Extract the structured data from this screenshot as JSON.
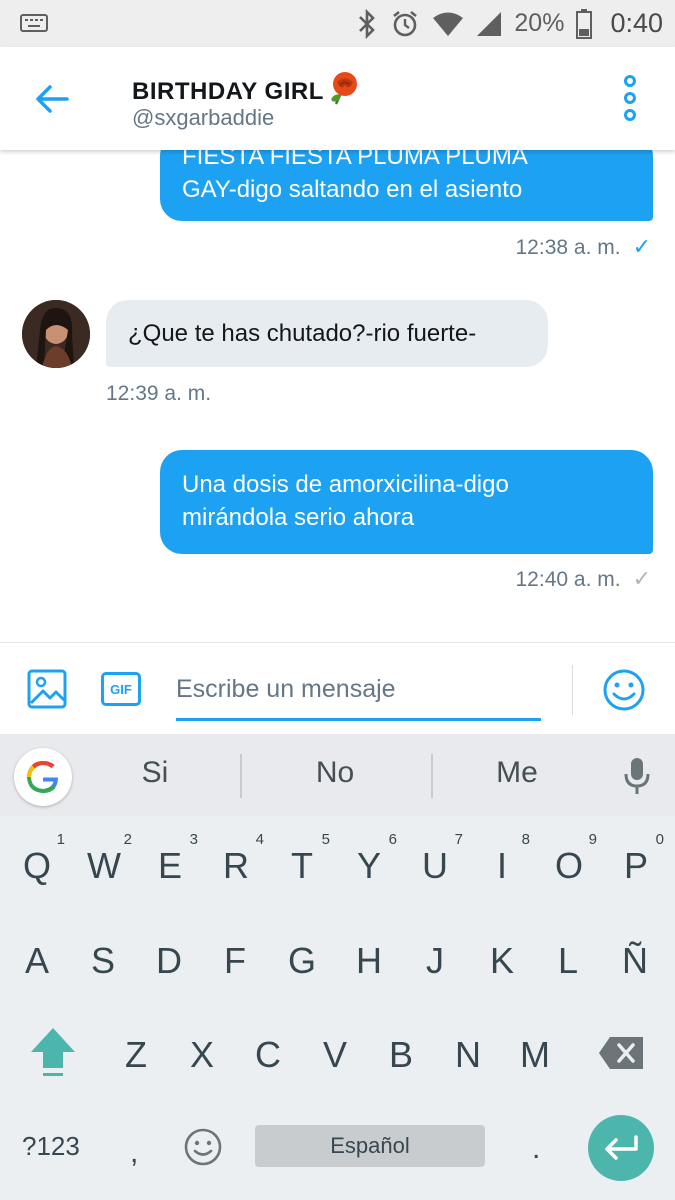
{
  "status_bar": {
    "battery_percent": "20%",
    "time": "0:40",
    "icons": [
      "keyboard-indicator-icon",
      "bluetooth-icon",
      "alarm-icon",
      "wifi-icon",
      "signal-icon",
      "battery-icon"
    ]
  },
  "header": {
    "title": "BIRTHDAY GIRL",
    "title_emoji": "rose-icon",
    "handle": "@sxgarbaddie",
    "accent_color": "#1da1f2"
  },
  "messages": [
    {
      "direction": "sent",
      "lines": [
        "FIESTA FIESTA PLUMA PLUMA",
        "GAY-digo saltando en el asiento"
      ],
      "time": "12:38 a. m.",
      "status": "✓",
      "status_color": "#1da1f2"
    },
    {
      "direction": "received",
      "text": "¿Que te has chutado?-rio fuerte-",
      "time": "12:39 a. m."
    },
    {
      "direction": "sent",
      "lines": [
        "Una dosis de amorxicilina-digo",
        "mirándola serio ahora"
      ],
      "time": "12:40 a. m.",
      "status": "✓",
      "status_color": "#aab8c2"
    }
  ],
  "composer": {
    "placeholder": "Escribe un mensaje",
    "gif_label": "GIF"
  },
  "keyboard": {
    "suggestions": [
      "Si",
      "No",
      "Me"
    ],
    "row1": [
      {
        "key": "Q",
        "hint": "1"
      },
      {
        "key": "W",
        "hint": "2"
      },
      {
        "key": "E",
        "hint": "3"
      },
      {
        "key": "R",
        "hint": "4"
      },
      {
        "key": "T",
        "hint": "5"
      },
      {
        "key": "Y",
        "hint": "6"
      },
      {
        "key": "U",
        "hint": "7"
      },
      {
        "key": "I",
        "hint": "8"
      },
      {
        "key": "O",
        "hint": "9"
      },
      {
        "key": "P",
        "hint": "0"
      }
    ],
    "row2": [
      "A",
      "S",
      "D",
      "F",
      "G",
      "H",
      "J",
      "K",
      "L",
      "Ñ"
    ],
    "row3": [
      "Z",
      "X",
      "C",
      "V",
      "B",
      "N",
      "M"
    ],
    "symbols_label": "?123",
    "comma": ",",
    "space_label": "Español",
    "period": "."
  }
}
